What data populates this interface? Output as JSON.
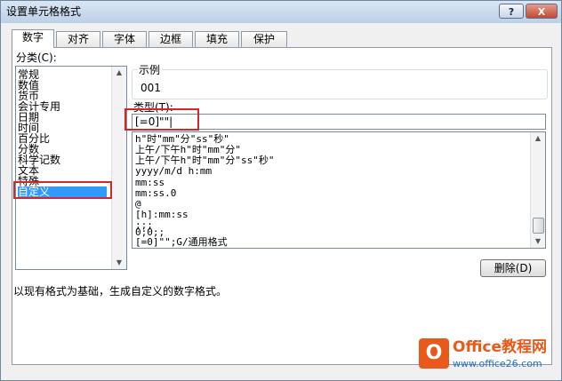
{
  "window": {
    "title": "设置单元格格式",
    "help_label": "?",
    "close_label": "X"
  },
  "tabs": [
    {
      "label": "数字",
      "active": true
    },
    {
      "label": "对齐",
      "active": false
    },
    {
      "label": "字体",
      "active": false
    },
    {
      "label": "边框",
      "active": false
    },
    {
      "label": "填充",
      "active": false
    },
    {
      "label": "保护",
      "active": false
    }
  ],
  "category": {
    "label": "分类(C):",
    "items": [
      "常规",
      "数值",
      "货币",
      "会计专用",
      "日期",
      "时间",
      "百分比",
      "分数",
      "科学记数",
      "文本",
      "特殊",
      "自定义"
    ],
    "selected": "自定义"
  },
  "sample": {
    "label": "示例",
    "value": "001"
  },
  "type_field": {
    "label": "类型(T):",
    "value": "[=0]\"\"|"
  },
  "format_list": [
    "h\"时\"mm\"分\"ss\"秒\"",
    "上午/下午h\"时\"mm\"分\"",
    "上午/下午h\"时\"mm\"分\"ss\"秒\"",
    "yyyy/m/d h:mm",
    "mm:ss",
    "mm:ss.0",
    "@",
    "[h]:mm:ss",
    ";;;",
    "0;0;;",
    "[=0]\"\";G/通用格式"
  ],
  "delete_button": {
    "label": "删除(D)"
  },
  "description": "以现有格式为基础，生成自定义的数字格式。",
  "watermark": {
    "logo": "O",
    "title": "Office教程网",
    "subtitle": "www.office26.com"
  },
  "colors": {
    "highlight_red": "#d7262b",
    "selection_blue": "#3399ff",
    "watermark_orange": "#e8591a"
  }
}
